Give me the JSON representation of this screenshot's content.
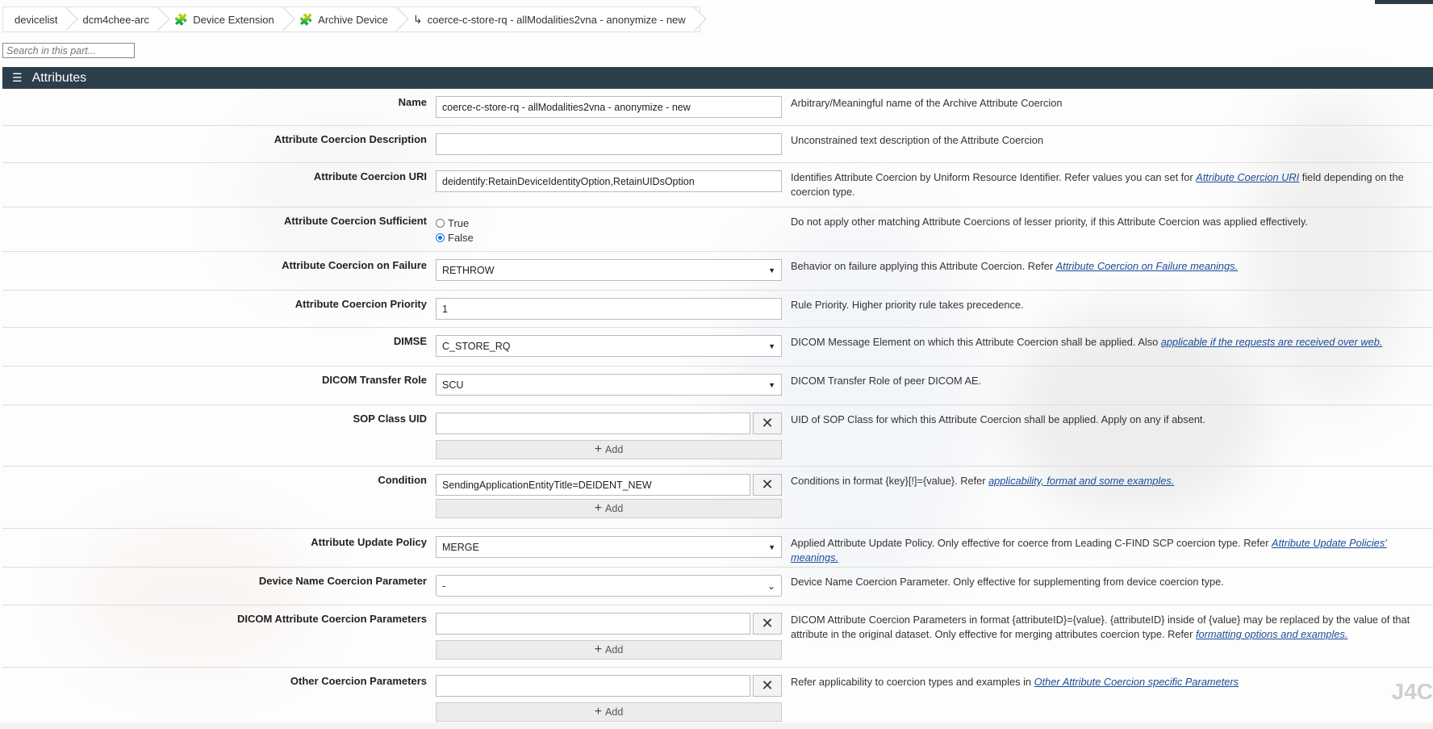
{
  "breadcrumbs": [
    {
      "label": "devicelist",
      "icon": ""
    },
    {
      "label": "dcm4chee-arc",
      "icon": ""
    },
    {
      "label": "Device Extension",
      "icon": "puzzle-icon"
    },
    {
      "label": "Archive Device",
      "icon": "puzzle-icon"
    },
    {
      "label": "coerce-c-store-rq - allModalities2vna - anonymize - new",
      "icon": "subdirectory-arrow-icon"
    }
  ],
  "search": {
    "placeholder": "Search in this part..."
  },
  "section": {
    "title": "Attributes",
    "icon": "list-icon"
  },
  "fields": {
    "name": {
      "label": "Name",
      "value": "coerce-c-store-rq - allModalities2vna - anonymize - new",
      "desc": "Arbitrary/Meaningful name of the Archive Attribute Coercion"
    },
    "description": {
      "label": "Attribute Coercion Description",
      "value": "",
      "desc": "Unconstrained text description of the Attribute Coercion"
    },
    "uri": {
      "label": "Attribute Coercion URI",
      "value": "deidentify:RetainDeviceIdentityOption,RetainUIDsOption",
      "desc_pre": "Identifies Attribute Coercion by Uniform Resource Identifier. Refer values you can set for ",
      "desc_link": "Attribute Coercion URI",
      "desc_post": " field depending on the coercion type."
    },
    "sufficient": {
      "label": "Attribute Coercion Sufficient",
      "options": [
        "True",
        "False"
      ],
      "selected": "False",
      "desc": "Do not apply other matching Attribute Coercions of lesser priority, if this Attribute Coercion was applied effectively."
    },
    "on_failure": {
      "label": "Attribute Coercion on Failure",
      "value": "RETHROW",
      "desc_pre": "Behavior on failure applying this Attribute Coercion. Refer ",
      "desc_link": "Attribute Coercion on Failure meanings."
    },
    "priority": {
      "label": "Attribute Coercion Priority",
      "value": "1",
      "desc": "Rule Priority. Higher priority rule takes precedence."
    },
    "dimse": {
      "label": "DIMSE",
      "value": "C_STORE_RQ",
      "desc_pre": "DICOM Message Element on which this Attribute Coercion shall be applied. Also ",
      "desc_link": "applicable if the requests are received over web."
    },
    "transfer_role": {
      "label": "DICOM Transfer Role",
      "value": "SCU",
      "desc": "DICOM Transfer Role of peer DICOM AE."
    },
    "sop_class": {
      "label": "SOP Class UID",
      "value": "",
      "desc": "UID of SOP Class for which this Attribute Coercion shall be applied. Apply on any if absent."
    },
    "condition": {
      "label": "Condition",
      "value": "SendingApplicationEntityTitle=DEIDENT_NEW",
      "desc_pre": "Conditions in format {key}[!]={value}. Refer ",
      "desc_link": "applicability, format and some examples."
    },
    "update_policy": {
      "label": "Attribute Update Policy",
      "value": "MERGE",
      "desc_pre": "Applied Attribute Update Policy. Only effective for coerce from Leading C-FIND SCP coercion type. Refer ",
      "desc_link": "Attribute Update Policies' meanings."
    },
    "device_name_param": {
      "label": "Device Name Coercion Parameter",
      "value": "-",
      "desc": "Device Name Coercion Parameter. Only effective for supplementing from device coercion type."
    },
    "dicom_attr_params": {
      "label": "DICOM Attribute Coercion Parameters",
      "value": "",
      "desc_pre": "DICOM Attribute Coercion Parameters in format {attributeID}={value}. {attributeID} inside of {value} may be replaced by the value of that attribute in the original dataset. Only effective for merging attributes coercion type. Refer ",
      "desc_link": "formatting options and examples."
    },
    "other_params": {
      "label": "Other Coercion Parameters",
      "value": "",
      "desc_pre": "Refer applicability to coercion types and examples in ",
      "desc_link": "Other Attribute Coercion specific Parameters"
    }
  },
  "add_label": "Add",
  "logo_text": "J4C"
}
